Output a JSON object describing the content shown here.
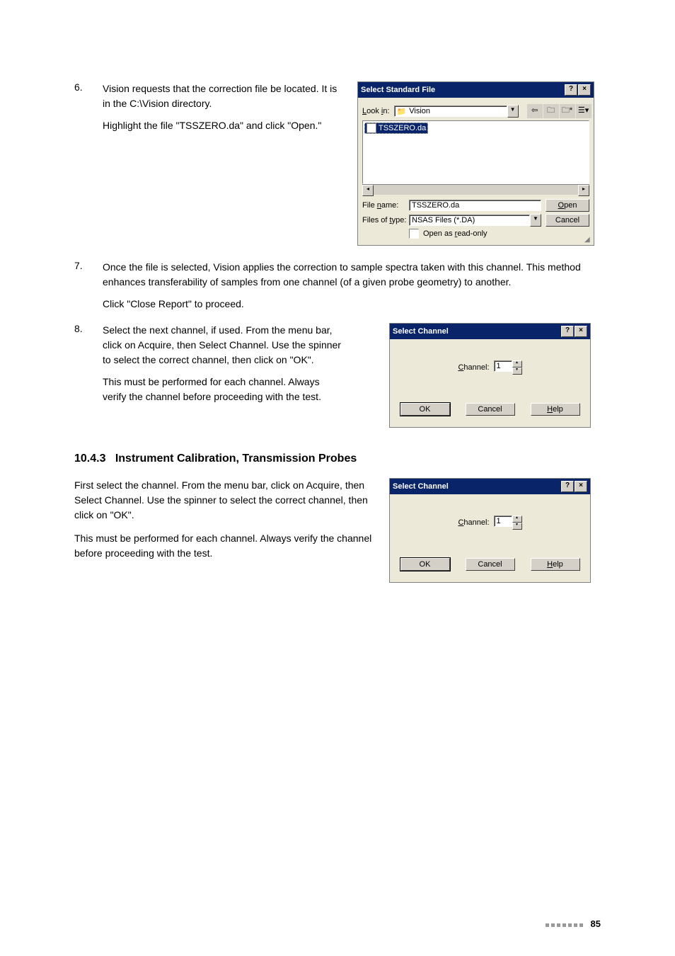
{
  "steps": {
    "s6": {
      "num": "6.",
      "p1": "Vision requests that the correction file be located. It is in the C:\\Vision directory.",
      "p2": "Highlight the file \"TSSZERO.da\" and click \"Open.\""
    },
    "s7": {
      "num": "7.",
      "p1": "Once the file is selected, Vision applies the correction to sample spectra taken with this channel. This method enhances transferability of samples from one channel (of a given probe geometry) to another.",
      "p2": "Click \"Close Report\" to proceed."
    },
    "s8": {
      "num": "8.",
      "p1": "Select the next channel, if used. From the menu bar, click on Acquire, then Select Channel. Use the spinner to select the correct channel, then click on \"OK\".",
      "p2": "This must be performed for each channel. Always verify the channel before proceeding with the test."
    }
  },
  "section": {
    "num": "10.4.3",
    "title": "Instrument Calibration, Transmission Probes",
    "p1": "First select the channel. From the menu bar, click on Acquire, then Select Channel. Use the spinner to select the correct channel, then click on \"OK\".",
    "p2": "This must be performed for each channel. Always verify the channel before proceeding with the test."
  },
  "file_dialog": {
    "title": "Select Standard File",
    "look_in_label": "Look in:",
    "look_in_value": "Vision",
    "file_item": "TSSZERO.da",
    "file_name_label": "File name:",
    "file_name_value": "TSSZERO.da",
    "file_type_label": "Files of type:",
    "file_type_value": "NSAS Files (*.DA)",
    "readonly_label": "Open as read-only",
    "open_btn": "Open",
    "cancel_btn": "Cancel"
  },
  "select_channel": {
    "title": "Select Channel",
    "channel_label": "Channel:",
    "channel_value": "1",
    "ok": "OK",
    "cancel": "Cancel",
    "help": "Help"
  },
  "footer": {
    "page": "85"
  }
}
